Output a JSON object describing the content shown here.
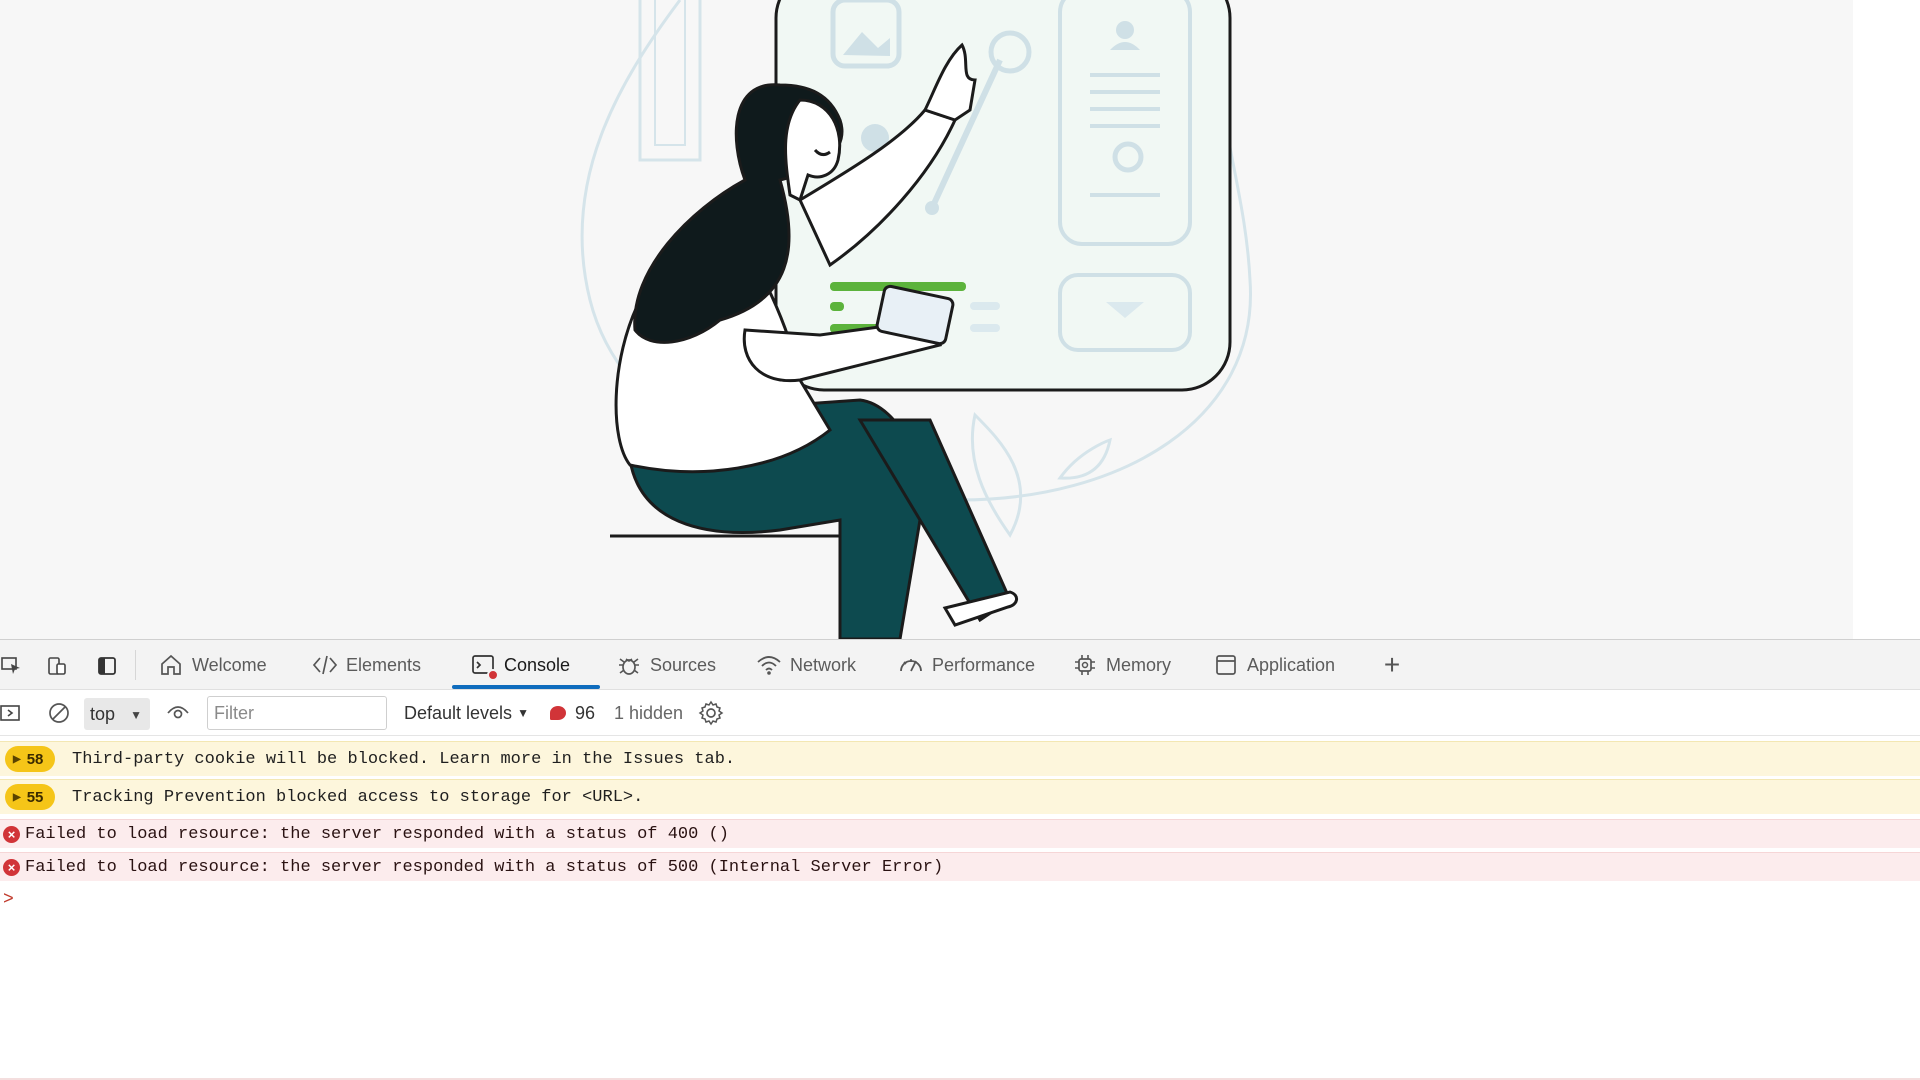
{
  "devtools": {
    "tabs": [
      {
        "label": "Welcome",
        "icon": "home-icon"
      },
      {
        "label": "Elements",
        "icon": "code-icon"
      },
      {
        "label": "Console",
        "icon": "console-icon",
        "active": true
      },
      {
        "label": "Sources",
        "icon": "bug-icon"
      },
      {
        "label": "Network",
        "icon": "wifi-icon"
      },
      {
        "label": "Performance",
        "icon": "gauge-icon"
      },
      {
        "label": "Memory",
        "icon": "chip-icon"
      },
      {
        "label": "Application",
        "icon": "window-icon"
      }
    ],
    "toolbar": {
      "context": "top",
      "filter_placeholder": "Filter",
      "levels": "Default levels",
      "issue_count": "96",
      "hidden": "1 hidden"
    },
    "messages": [
      {
        "type": "warning",
        "count": "58",
        "text": "Third-party cookie will be blocked. Learn more in the Issues tab."
      },
      {
        "type": "warning",
        "count": "55",
        "text": "Tracking Prevention blocked access to storage for <URL>."
      },
      {
        "type": "error",
        "text": "Failed to load resource: the server responded with a status of 400 ()"
      },
      {
        "type": "error",
        "text": "Failed to load resource: the server responded with a status of 500 (Internal Server Error)"
      }
    ],
    "prompt": ">"
  },
  "colors": {
    "accent": "#0f6cbd",
    "warning_bg": "#fdf6dc",
    "warning_badge": "#f5c518",
    "error_bg": "#fceced",
    "error_icon": "#d13438",
    "illustration_teal": "#0d4a4f",
    "illustration_green": "#5cb33c"
  }
}
